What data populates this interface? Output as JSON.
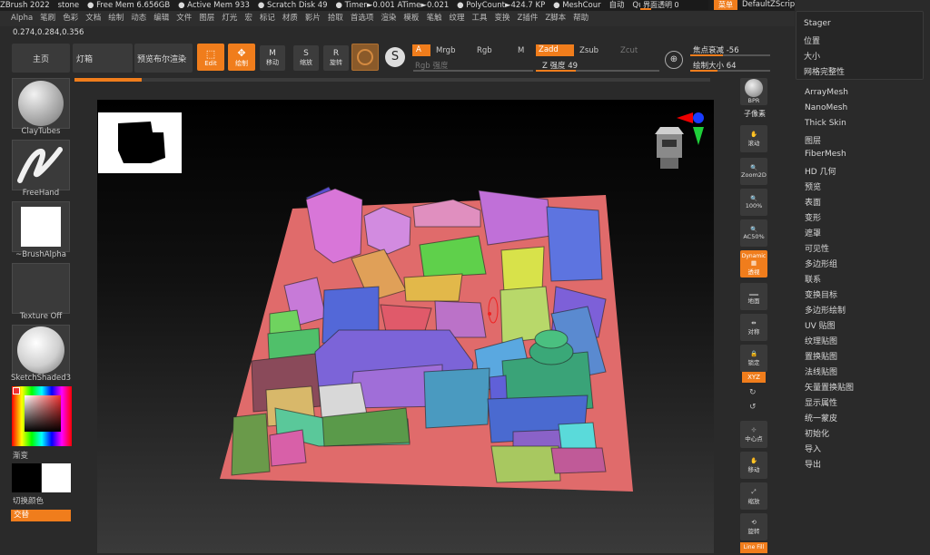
{
  "title_bar": {
    "items": [
      "ZBrush 2022",
      "stone",
      "● Free Mem 6.656GB",
      "● Active Mem 933",
      "● Scratch Disk 49",
      "● Timer►0.001 ATime►0.021",
      "● PolyCount►424.7 KP",
      "● MeshCour",
      "自动",
      "QuickSave"
    ],
    "transparency_label": "界面透明 0",
    "menu_label": "菜单",
    "script_label": "DefaultZScript"
  },
  "menu_bar": [
    "Alpha",
    "笔刷",
    "色彩",
    "文档",
    "绘制",
    "动态",
    "编辑",
    "文件",
    "图层",
    "灯光",
    "宏",
    "标记",
    "材质",
    "影片",
    "拾取",
    "首选项",
    "渲染",
    "模板",
    "笔触",
    "纹理",
    "工具",
    "变换",
    "Z插件",
    "Z脚本",
    "帮助"
  ],
  "coords": "0.274,0.284,0.356",
  "top_buttons": {
    "home": "主页",
    "lightbox": "灯箱",
    "preview_boolean": "预览布尔渲染"
  },
  "tool_buttons": [
    {
      "label": "Edit",
      "active": true
    },
    {
      "label": "绘制",
      "active": true
    },
    {
      "label": "移动",
      "active": false
    },
    {
      "label": "缩放",
      "active": false
    },
    {
      "label": "旋转",
      "active": false
    }
  ],
  "draw_options": {
    "a": "A",
    "mrgb": "Mrgb",
    "rgb": "Rgb",
    "m": "M",
    "zadd": "Zadd",
    "zsub": "Zsub",
    "zcut": "Zcut",
    "rgb_intensity": "Rgb 强度",
    "z_intensity_label": "Z 强度",
    "z_intensity_value": "49",
    "focal_label": "焦点衰减",
    "focal_value": "-56",
    "draw_size_label": "绘制大小",
    "draw_size_value": "64"
  },
  "left_panel": {
    "brush": "ClayTubes",
    "stroke": "FreeHand",
    "alpha": "~BrushAlpha",
    "texture": "Texture Off",
    "material": "SketchShaded3",
    "gradient": "渐变",
    "switch_color": "切换颜色",
    "alternate": "交替"
  },
  "right_bar": [
    "BPR",
    "子像素",
    "滚动",
    "Zoom2D",
    "100%",
    "AC50%",
    "Dynamic",
    "透视",
    "地面",
    "对称",
    "锁定",
    "XYZ",
    "中心点",
    "移动",
    "缩放",
    "旋转",
    "Line Fill"
  ],
  "popup": [
    "Stager",
    "位置",
    "大小",
    "网格完整性"
  ],
  "tool_menu": [
    "ArrayMesh",
    "NanoMesh",
    "Thick Skin",
    "图层",
    "FiberMesh",
    "HD 几何",
    "预览",
    "表面",
    "变形",
    "遮罩",
    "可见性",
    "多边形组",
    "联系",
    "变换目标",
    "多边形绘制",
    "UV 贴图",
    "纹理贴图",
    "置换贴图",
    "法线贴图",
    "矢量置换贴图",
    "显示属性",
    "统一蒙皮",
    "初始化",
    "导入",
    "导出"
  ],
  "colors": {
    "accent": "#f07d1c",
    "ground": "#e06b6b"
  }
}
